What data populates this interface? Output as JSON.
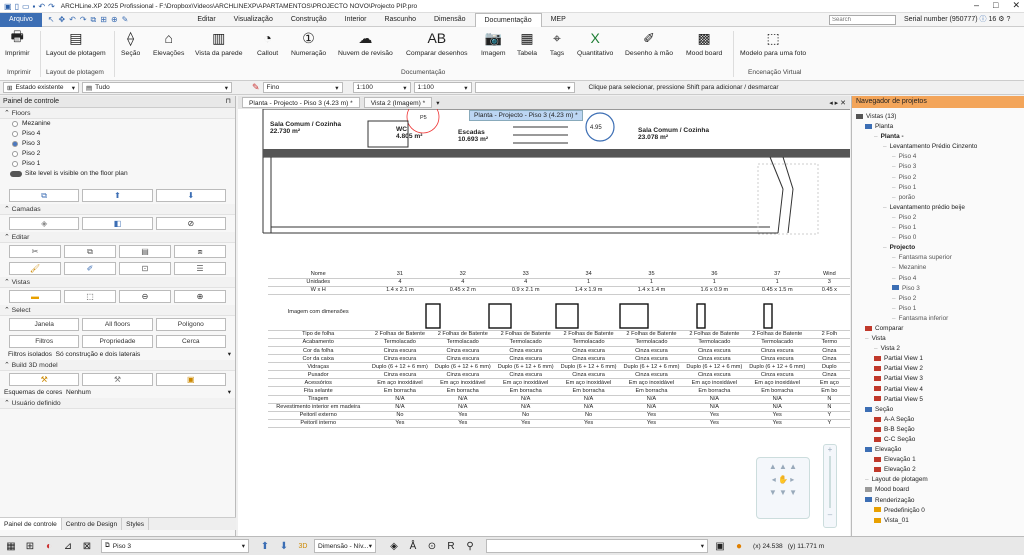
{
  "title": "ARCHLine.XP 2025 Profissional - F:\\Dropbox\\Videos\\ARCHLINEXP\\APARTAMENTOS\\PROJECTO NOVO\\Projecto PIP.pro",
  "serial": "Serial number (950777)",
  "notif_count": "16",
  "menu": [
    "Arquivo",
    "Editar",
    "Visualização",
    "Construção",
    "Interior",
    "Rascunho",
    "Dimensão",
    "Documentação",
    "MEP"
  ],
  "search_placeholder": "Search",
  "ribbon": {
    "buttons": [
      "Imprimir",
      "Layout de plotagem",
      "Seção",
      "Elevações",
      "Vista da parede",
      "Callout",
      "Numeração",
      "Nuvem de revisão",
      "Comparar desenhos",
      "Imagem",
      "Tabela",
      "Tags",
      "Quantitativo",
      "Desenho à mão",
      "Mood board",
      "Modelo para uma foto"
    ],
    "groups": [
      "Imprimir",
      "Layout de plotagem",
      "Documentação",
      "Encenação Virtual"
    ]
  },
  "toolbar2": {
    "state": "Estado existente",
    "all": "Tudo",
    "linetype": "Fino",
    "scale1": "1:100",
    "scale2": "1:100",
    "hint": "Clique para selecionar, pressione Shift para adicionar / desmarcar"
  },
  "left_panel": {
    "title": "Painel de controle",
    "floors_title": "Floors",
    "floors": [
      "Mezanine",
      "Piso 4",
      "Piso 3",
      "Piso 2",
      "Piso 1"
    ],
    "selected_floor": "Piso 3",
    "site_level": "Site level is visible on the floor plan",
    "camadas": "Camadas",
    "editar": "Editar",
    "vistas": "Vistas",
    "select": "Select",
    "select_buttons": [
      "Janela",
      "All floors",
      "Polígono",
      "Filtros",
      "Propriedade",
      "Cerca"
    ],
    "filtros_label": "Filtros isolados",
    "filtros_value": "Só construção e dois laterais",
    "build3d": "Build 3D model",
    "esquemas_label": "Esquemas de cores",
    "esquemas_value": "Nenhum",
    "usuario": "Usuário definido",
    "tabs": [
      "Painel de controle",
      "Centro de Design",
      "Styles"
    ]
  },
  "doc_tabs": [
    "Planta - Projecto - Piso 3 (4.23 m) *",
    "Vista 2 (Imagem) *"
  ],
  "canvas": {
    "tooltip": "Planta - Projecto - Piso 3 (4.23 m) *",
    "rooms": [
      {
        "name": "Sala Comum / Cozinha",
        "area": "22.730 m²"
      },
      {
        "name": "WC",
        "area": "4.805 m²"
      },
      {
        "name": "Escadas",
        "area": "10.693 m²"
      },
      {
        "name": "Sala Comum / Cozinha",
        "area": "23.078 m²"
      },
      {
        "name": "P5",
        "area": ""
      },
      {
        "name": "4.95",
        "area": ""
      }
    ]
  },
  "schedule": {
    "columns": [
      "31",
      "32",
      "33",
      "34",
      "35",
      "36",
      "37",
      "Wind"
    ],
    "rows": [
      {
        "label": "Nome",
        "values": [
          "31",
          "32",
          "33",
          "34",
          "35",
          "36",
          "37",
          "Wind"
        ]
      },
      {
        "label": "Unidades",
        "values": [
          "4",
          "4",
          "4",
          "1",
          "1",
          "1",
          "1",
          "3"
        ]
      },
      {
        "label": "W x H",
        "values": [
          "1.4 x 2.1 m",
          "0.45 x 2 m",
          "0.9 x 2.1 m",
          "1.4 x 1.9 m",
          "1.4 x 1.4 m",
          "1.6 x 0.9 m",
          "0.45 x 1.5 m",
          "0.45 x"
        ]
      },
      {
        "label": "Imagem com dimensões",
        "values": [
          "",
          "",
          "",
          "",
          "",
          "",
          "",
          ""
        ]
      },
      {
        "label": "Tipo de folha",
        "values": [
          "2 Folhas de Batente",
          "2 Folhas de Batente",
          "2 Folhas de Batente",
          "2 Folhas de Batente",
          "2 Folhas de Batente",
          "2 Folhas de Batente",
          "2 Folhas de Batente",
          "2 Folh"
        ]
      },
      {
        "label": "Acabamento",
        "values": [
          "Termolacado",
          "Termolacado",
          "Termolacado",
          "Termolacado",
          "Termolacado",
          "Termolacado",
          "Termolacado",
          "Termo"
        ]
      },
      {
        "label": "Cor da folha",
        "values": [
          "Cinza escura",
          "Cinza escura",
          "Cinza escura",
          "Cinza escura",
          "Cinza escura",
          "Cinza escura",
          "Cinza escura",
          "Cinza"
        ]
      },
      {
        "label": "Cor da caixa",
        "values": [
          "Cinza escura",
          "Cinza escura",
          "Cinza escura",
          "Cinza escura",
          "Cinza escura",
          "Cinza escura",
          "Cinza escura",
          "Cinza"
        ]
      },
      {
        "label": "Vidraças",
        "values": [
          "Duplo (6 + 12 + 6 mm)",
          "Duplo (6 + 12 + 6 mm)",
          "Duplo (6 + 12 + 6 mm)",
          "Duplo (6 + 12 + 6 mm)",
          "Duplo (6 + 12 + 6 mm)",
          "Duplo (6 + 12 + 6 mm)",
          "Duplo (6 + 12 + 6 mm)",
          "Duplo"
        ]
      },
      {
        "label": "Puxador",
        "values": [
          "Cinza escura",
          "Cinza escura",
          "Cinza escura",
          "Cinza escura",
          "Cinza escura",
          "Cinza escura",
          "Cinza escura",
          "Cinza"
        ]
      },
      {
        "label": "Acessórios",
        "values": [
          "Em aço inoxidável",
          "Em aço inoxidável",
          "Em aço inoxidável",
          "Em aço inoxidável",
          "Em aço inoxidável",
          "Em aço inoxidável",
          "Em aço inoxidável",
          "Em aço"
        ]
      },
      {
        "label": "Fita selante",
        "values": [
          "Em borracha",
          "Em borracha",
          "Em borracha",
          "Em borracha",
          "Em borracha",
          "Em borracha",
          "Em borracha",
          "Em bo"
        ]
      },
      {
        "label": "Tiragem",
        "values": [
          "N/A",
          "N/A",
          "N/A",
          "N/A",
          "N/A",
          "N/A",
          "N/A",
          "N"
        ]
      },
      {
        "label": "Revestimento interior em madeira",
        "values": [
          "N/A",
          "N/A",
          "N/A",
          "N/A",
          "N/A",
          "N/A",
          "N/A",
          "N"
        ]
      },
      {
        "label": "Peitoril externo",
        "values": [
          "No",
          "Yes",
          "No",
          "No",
          "Yes",
          "Yes",
          "Yes",
          "Y"
        ]
      },
      {
        "label": "Peitoril interno",
        "values": [
          "Yes",
          "Yes",
          "Yes",
          "Yes",
          "Yes",
          "Yes",
          "Yes",
          "Y"
        ]
      }
    ]
  },
  "nav_panel": {
    "title": "Navegador de projetos",
    "tree": [
      {
        "t": "Vistas (13)",
        "d": 0,
        "k": "f"
      },
      {
        "t": "Planta",
        "d": 1,
        "k": "p"
      },
      {
        "t": "Planta -",
        "d": 2,
        "k": "b"
      },
      {
        "t": "Levantamento Prédio Cinzento",
        "d": 3,
        "k": ""
      },
      {
        "t": "Piso 4",
        "d": 4,
        "k": ""
      },
      {
        "t": "Piso 3",
        "d": 4,
        "k": ""
      },
      {
        "t": "Piso 2",
        "d": 4,
        "k": ""
      },
      {
        "t": "Piso 1",
        "d": 4,
        "k": ""
      },
      {
        "t": "porão",
        "d": 4,
        "k": ""
      },
      {
        "t": "Levantamento prédio beije",
        "d": 3,
        "k": ""
      },
      {
        "t": "Piso 2",
        "d": 4,
        "k": ""
      },
      {
        "t": "Piso 1",
        "d": 4,
        "k": ""
      },
      {
        "t": "Piso 0",
        "d": 4,
        "k": ""
      },
      {
        "t": "Projecto",
        "d": 3,
        "k": "b"
      },
      {
        "t": "Fantasma superior",
        "d": 4,
        "k": ""
      },
      {
        "t": "Mezanine",
        "d": 4,
        "k": ""
      },
      {
        "t": "Piso 4",
        "d": 4,
        "k": ""
      },
      {
        "t": "Piso 3",
        "d": 4,
        "k": "s"
      },
      {
        "t": "Piso 2",
        "d": 4,
        "k": ""
      },
      {
        "t": "Piso 1",
        "d": 4,
        "k": ""
      },
      {
        "t": "Fantasma inferior",
        "d": 4,
        "k": ""
      },
      {
        "t": "Comparar",
        "d": 1,
        "k": "r"
      },
      {
        "t": "Vista",
        "d": 1,
        "k": ""
      },
      {
        "t": "Vista 2",
        "d": 2,
        "k": ""
      },
      {
        "t": "Partial View 1",
        "d": 2,
        "k": "r"
      },
      {
        "t": "Partial View 2",
        "d": 2,
        "k": "r"
      },
      {
        "t": "Partial View 3",
        "d": 2,
        "k": "r"
      },
      {
        "t": "Partial View 4",
        "d": 2,
        "k": "r"
      },
      {
        "t": "Partial View 5",
        "d": 2,
        "k": "r"
      },
      {
        "t": "Seção",
        "d": 1,
        "k": "p"
      },
      {
        "t": "A-A Seção",
        "d": 2,
        "k": "r"
      },
      {
        "t": "B-B Seção",
        "d": 2,
        "k": "r"
      },
      {
        "t": "C-C Seção",
        "d": 2,
        "k": "r"
      },
      {
        "t": "Elevação",
        "d": 1,
        "k": "p"
      },
      {
        "t": "Elevação 1",
        "d": 2,
        "k": "r"
      },
      {
        "t": "Elevação 2",
        "d": 2,
        "k": "r"
      },
      {
        "t": "Layout de plotagem",
        "d": 1,
        "k": ""
      },
      {
        "t": "Mood board",
        "d": 1,
        "k": "g"
      },
      {
        "t": "Renderização",
        "d": 1,
        "k": "p"
      },
      {
        "t": "Predefinição 0",
        "d": 2,
        "k": "y"
      },
      {
        "t": "Vista_01",
        "d": 2,
        "k": "y"
      }
    ]
  },
  "statusbar": {
    "floor": "Piso 3",
    "dim": "Dimensão - Nív...",
    "coords_x": "(x) 24.538",
    "coords_y": "(y) 11.771 m"
  },
  "colors": {
    "accent": "#3c6eb4",
    "nav_header": "#f3a55a",
    "tooltip": "#bcd6f3"
  }
}
